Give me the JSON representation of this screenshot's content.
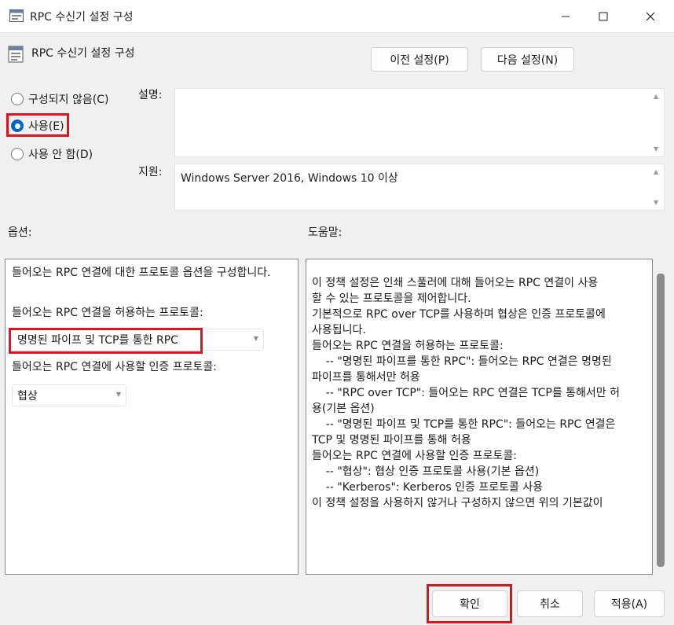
{
  "window": {
    "title": "RPC 수신기 설정 구성"
  },
  "header": {
    "title": "RPC 수신기 설정 구성",
    "prev_button": "이전 설정(P)",
    "next_button": "다음 설정(N)"
  },
  "state_options": [
    {
      "label": "구성되지 않음(C)",
      "selected": false
    },
    {
      "label": "사용(E)",
      "selected": true
    },
    {
      "label": "사용 안 함(D)",
      "selected": false
    }
  ],
  "description": {
    "label": "설명:",
    "value": ""
  },
  "support": {
    "label": "지원:",
    "value": "Windows Server 2016, Windows 10 이상"
  },
  "options": {
    "label": "옵션:",
    "intro": "들어오는 RPC 연결에 대한 프로토콜 옵션을 구성합니다.",
    "protocol_label": "들어오는 RPC 연결을 허용하는 프로토콜:",
    "protocol_value": "명명된 파이프 및 TCP를 통한 RPC",
    "auth_label": "들어오는 RPC 연결에 사용할 인증 프로토콜:",
    "auth_value": "협상"
  },
  "help": {
    "label": "도움말:",
    "lines": [
      "이 정책 설정은 인쇄 스풀러에 대해 들어오는 RPC 연결이 사용",
      "할 수 있는 프로토콜을 제어합니다.",
      "",
      "기본적으로 RPC over TCP를 사용하며 협상은 인증 프로토콜에",
      "사용됩니다.",
      "",
      "들어오는 RPC 연결을 허용하는 프로토콜:",
      "    -- \"명명된 파이프를 통한 RPC\": 들어오는 RPC 연결은 명명된",
      "파이프를 통해서만 허용",
      "    -- \"RPC over TCP\": 들어오는 RPC 연결은 TCP를 통해서만 허",
      "용(기본 옵션)",
      "    -- \"명명된 파이프 및 TCP를 통한 RPC\": 들어오는 RPC 연결은",
      "TCP 및 명명된 파이프를 통해 허용",
      "",
      "들어오는 RPC 연결에 사용할 인증 프로토콜:",
      "    -- \"협상\": 협상 인증 프로토콜 사용(기본 옵션)",
      "    -- \"Kerberos\": Kerberos 인증 프로토콜 사용",
      "",
      "이 정책 설정을 사용하지 않거나 구성하지 않으면 위의 기본값이"
    ]
  },
  "footer": {
    "ok": "확인",
    "cancel": "취소",
    "apply": "적용(A)"
  },
  "colors": {
    "accent": "#0067c0",
    "highlight": "#e0121e"
  },
  "icons": [
    "policy-icon",
    "minimize-icon",
    "maximize-icon",
    "close-icon",
    "chevron-down-icon",
    "scroll-up-icon",
    "scroll-down-icon"
  ]
}
